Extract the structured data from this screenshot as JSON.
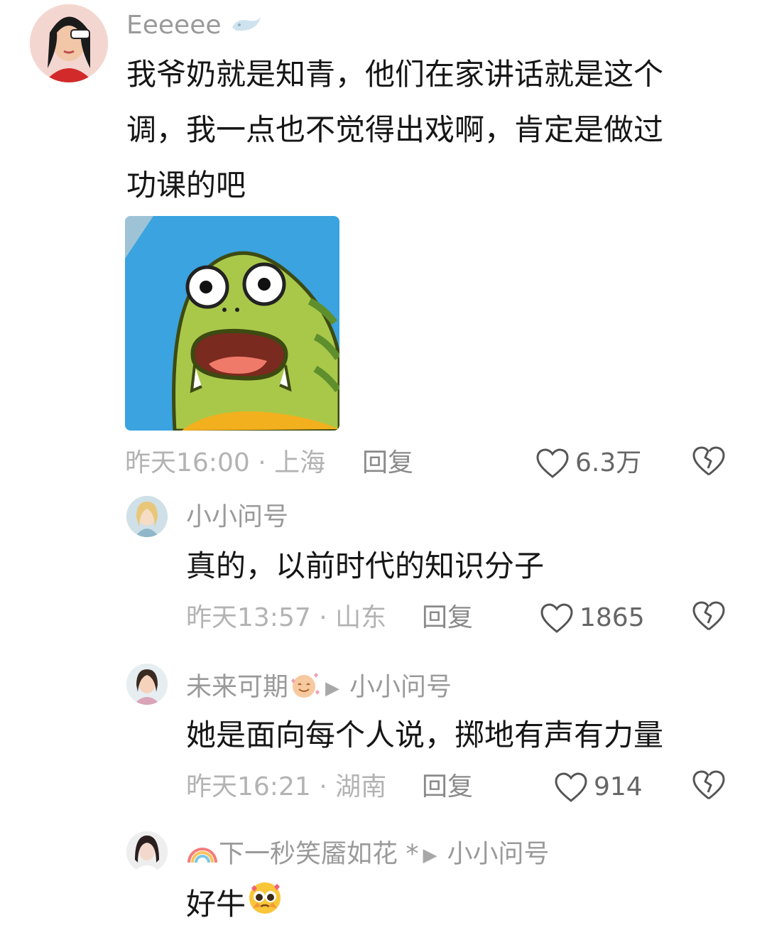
{
  "comments": [
    {
      "username": "Eeeeee",
      "text_line1": "我爷奶就是知青，他们在家讲话就是这个",
      "text_line2": "调，我一点也不觉得出戏啊，肯定是做过",
      "text_line3": "功课的吧",
      "image": "green-fish-shocked-sticker",
      "meta": "昨天16:00 · 上海",
      "reply_label": "回复",
      "likes": "6.3万"
    },
    {
      "username": "小小问号",
      "text": "真的，以前时代的知识分子",
      "meta": "昨天13:57 · 山东",
      "reply_label": "回复",
      "likes": "1865"
    },
    {
      "username": "未来可期",
      "reply_to": "小小问号",
      "text": "她是面向每个人说，掷地有声有力量",
      "meta": "昨天16:21 · 湖南",
      "reply_label": "回复",
      "likes": "914"
    },
    {
      "username": "下一秒笑靥如花 *",
      "reply_to": "小小问号",
      "text": "好牛",
      "emoji": "pleading-face"
    }
  ],
  "colors": {
    "meta": "#b3b3b3",
    "username": "#9a9a9a",
    "text": "#161616"
  }
}
